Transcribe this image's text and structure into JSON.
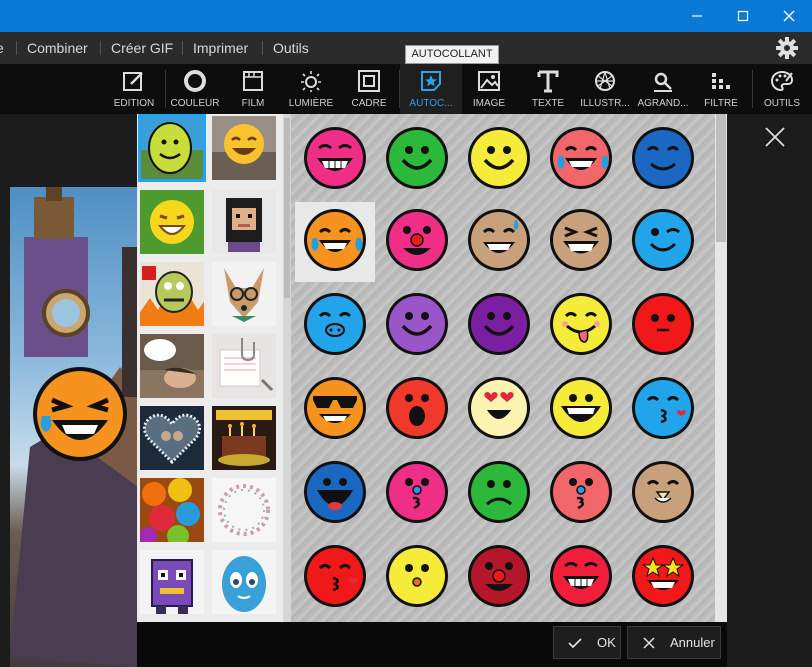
{
  "titlebar": {
    "minimize_icon": "minimize-icon",
    "maximize_icon": "maximize-icon",
    "close_icon": "close-icon"
  },
  "menu": {
    "items": [
      "e",
      "Combiner",
      "Créer GIF",
      "Imprimer",
      "Outils"
    ],
    "settings_icon": "gear-icon"
  },
  "toolbar": {
    "items": [
      {
        "label": "EDITION",
        "icon": "edit-icon"
      },
      {
        "label": "COULEUR",
        "icon": "color-ring-icon"
      },
      {
        "label": "FILM",
        "icon": "film-frame-icon"
      },
      {
        "label": "LUMIÈRE",
        "icon": "sun-icon"
      },
      {
        "label": "CADRE",
        "icon": "frame-icon"
      },
      {
        "label": "AUTOC...",
        "icon": "sticker-star-icon",
        "active": true
      },
      {
        "label": "IMAGE",
        "icon": "image-icon"
      },
      {
        "label": "TEXTE",
        "icon": "text-icon"
      },
      {
        "label": "ILLUSTR...",
        "icon": "illustration-icon"
      },
      {
        "label": "AGRAND...",
        "icon": "magnify-icon"
      },
      {
        "label": "FILTRE",
        "icon": "filter-icon"
      },
      {
        "label": "OUTILS",
        "icon": "palette-icon"
      }
    ],
    "tooltip": "AUTOCOLLANT",
    "accent": "#2aa3e8"
  },
  "sticker_categories": [
    "smiley-yellow",
    "emoji-face",
    "laughing-face",
    "pixel-character",
    "angry-cartoon",
    "dog-glasses",
    "comic-photo",
    "paperclip-note",
    "heart-frame",
    "birthday",
    "balloons",
    "floral-circle",
    "purple-robot",
    "blue-egg"
  ],
  "stickers": [
    {
      "bg": "#ef2e86",
      "kind": "grin"
    },
    {
      "bg": "#2cb83a",
      "kind": "smile"
    },
    {
      "bg": "#f5ec3a",
      "kind": "smile"
    },
    {
      "bg": "#f0666a",
      "kind": "tears"
    },
    {
      "bg": "#1a68c2",
      "kind": "closed"
    },
    {
      "bg": "#f6921e",
      "kind": "tears",
      "selected": true
    },
    {
      "bg": "#ef2e86",
      "kind": "clown"
    },
    {
      "bg": "#c9a07c",
      "kind": "sweat"
    },
    {
      "bg": "#c9a07c",
      "kind": "laugh"
    },
    {
      "bg": "#22a4ea",
      "kind": "wink"
    },
    {
      "bg": "#22a4ea",
      "kind": "pig"
    },
    {
      "bg": "#9a55c9",
      "kind": "smile"
    },
    {
      "bg": "#7b1fa2",
      "kind": "smile"
    },
    {
      "bg": "#f5ec3a",
      "kind": "tongue"
    },
    {
      "bg": "#f01818",
      "kind": "blank"
    },
    {
      "bg": "#f6921e",
      "kind": "sunglasses"
    },
    {
      "bg": "#f0392a",
      "kind": "shock"
    },
    {
      "bg": "#fbf3b0",
      "kind": "hearteyes"
    },
    {
      "bg": "#f5ec3a",
      "kind": "bigsmile"
    },
    {
      "bg": "#22a4ea",
      "kind": "kiss"
    },
    {
      "bg": "#1a68c2",
      "kind": "wide"
    },
    {
      "bg": "#ef2e86",
      "kind": "number3"
    },
    {
      "bg": "#2cb83a",
      "kind": "sad"
    },
    {
      "bg": "#f0666a",
      "kind": "number3"
    },
    {
      "bg": "#c9a07c",
      "kind": "beak"
    },
    {
      "bg": "#f01818",
      "kind": "kiss"
    },
    {
      "bg": "#f5ec3a",
      "kind": "dots"
    },
    {
      "bg": "#b5162a",
      "kind": "clown"
    },
    {
      "bg": "#ef1e3a",
      "kind": "grin"
    },
    {
      "bg": "#f01818",
      "kind": "stareyes"
    }
  ],
  "canvas": {
    "sticker_color": "#f6921e",
    "close_icon": "close-icon"
  },
  "dialog": {
    "ok": "OK",
    "cancel": "Annuler",
    "ok_icon": "check-icon",
    "cancel_icon": "x-icon"
  }
}
